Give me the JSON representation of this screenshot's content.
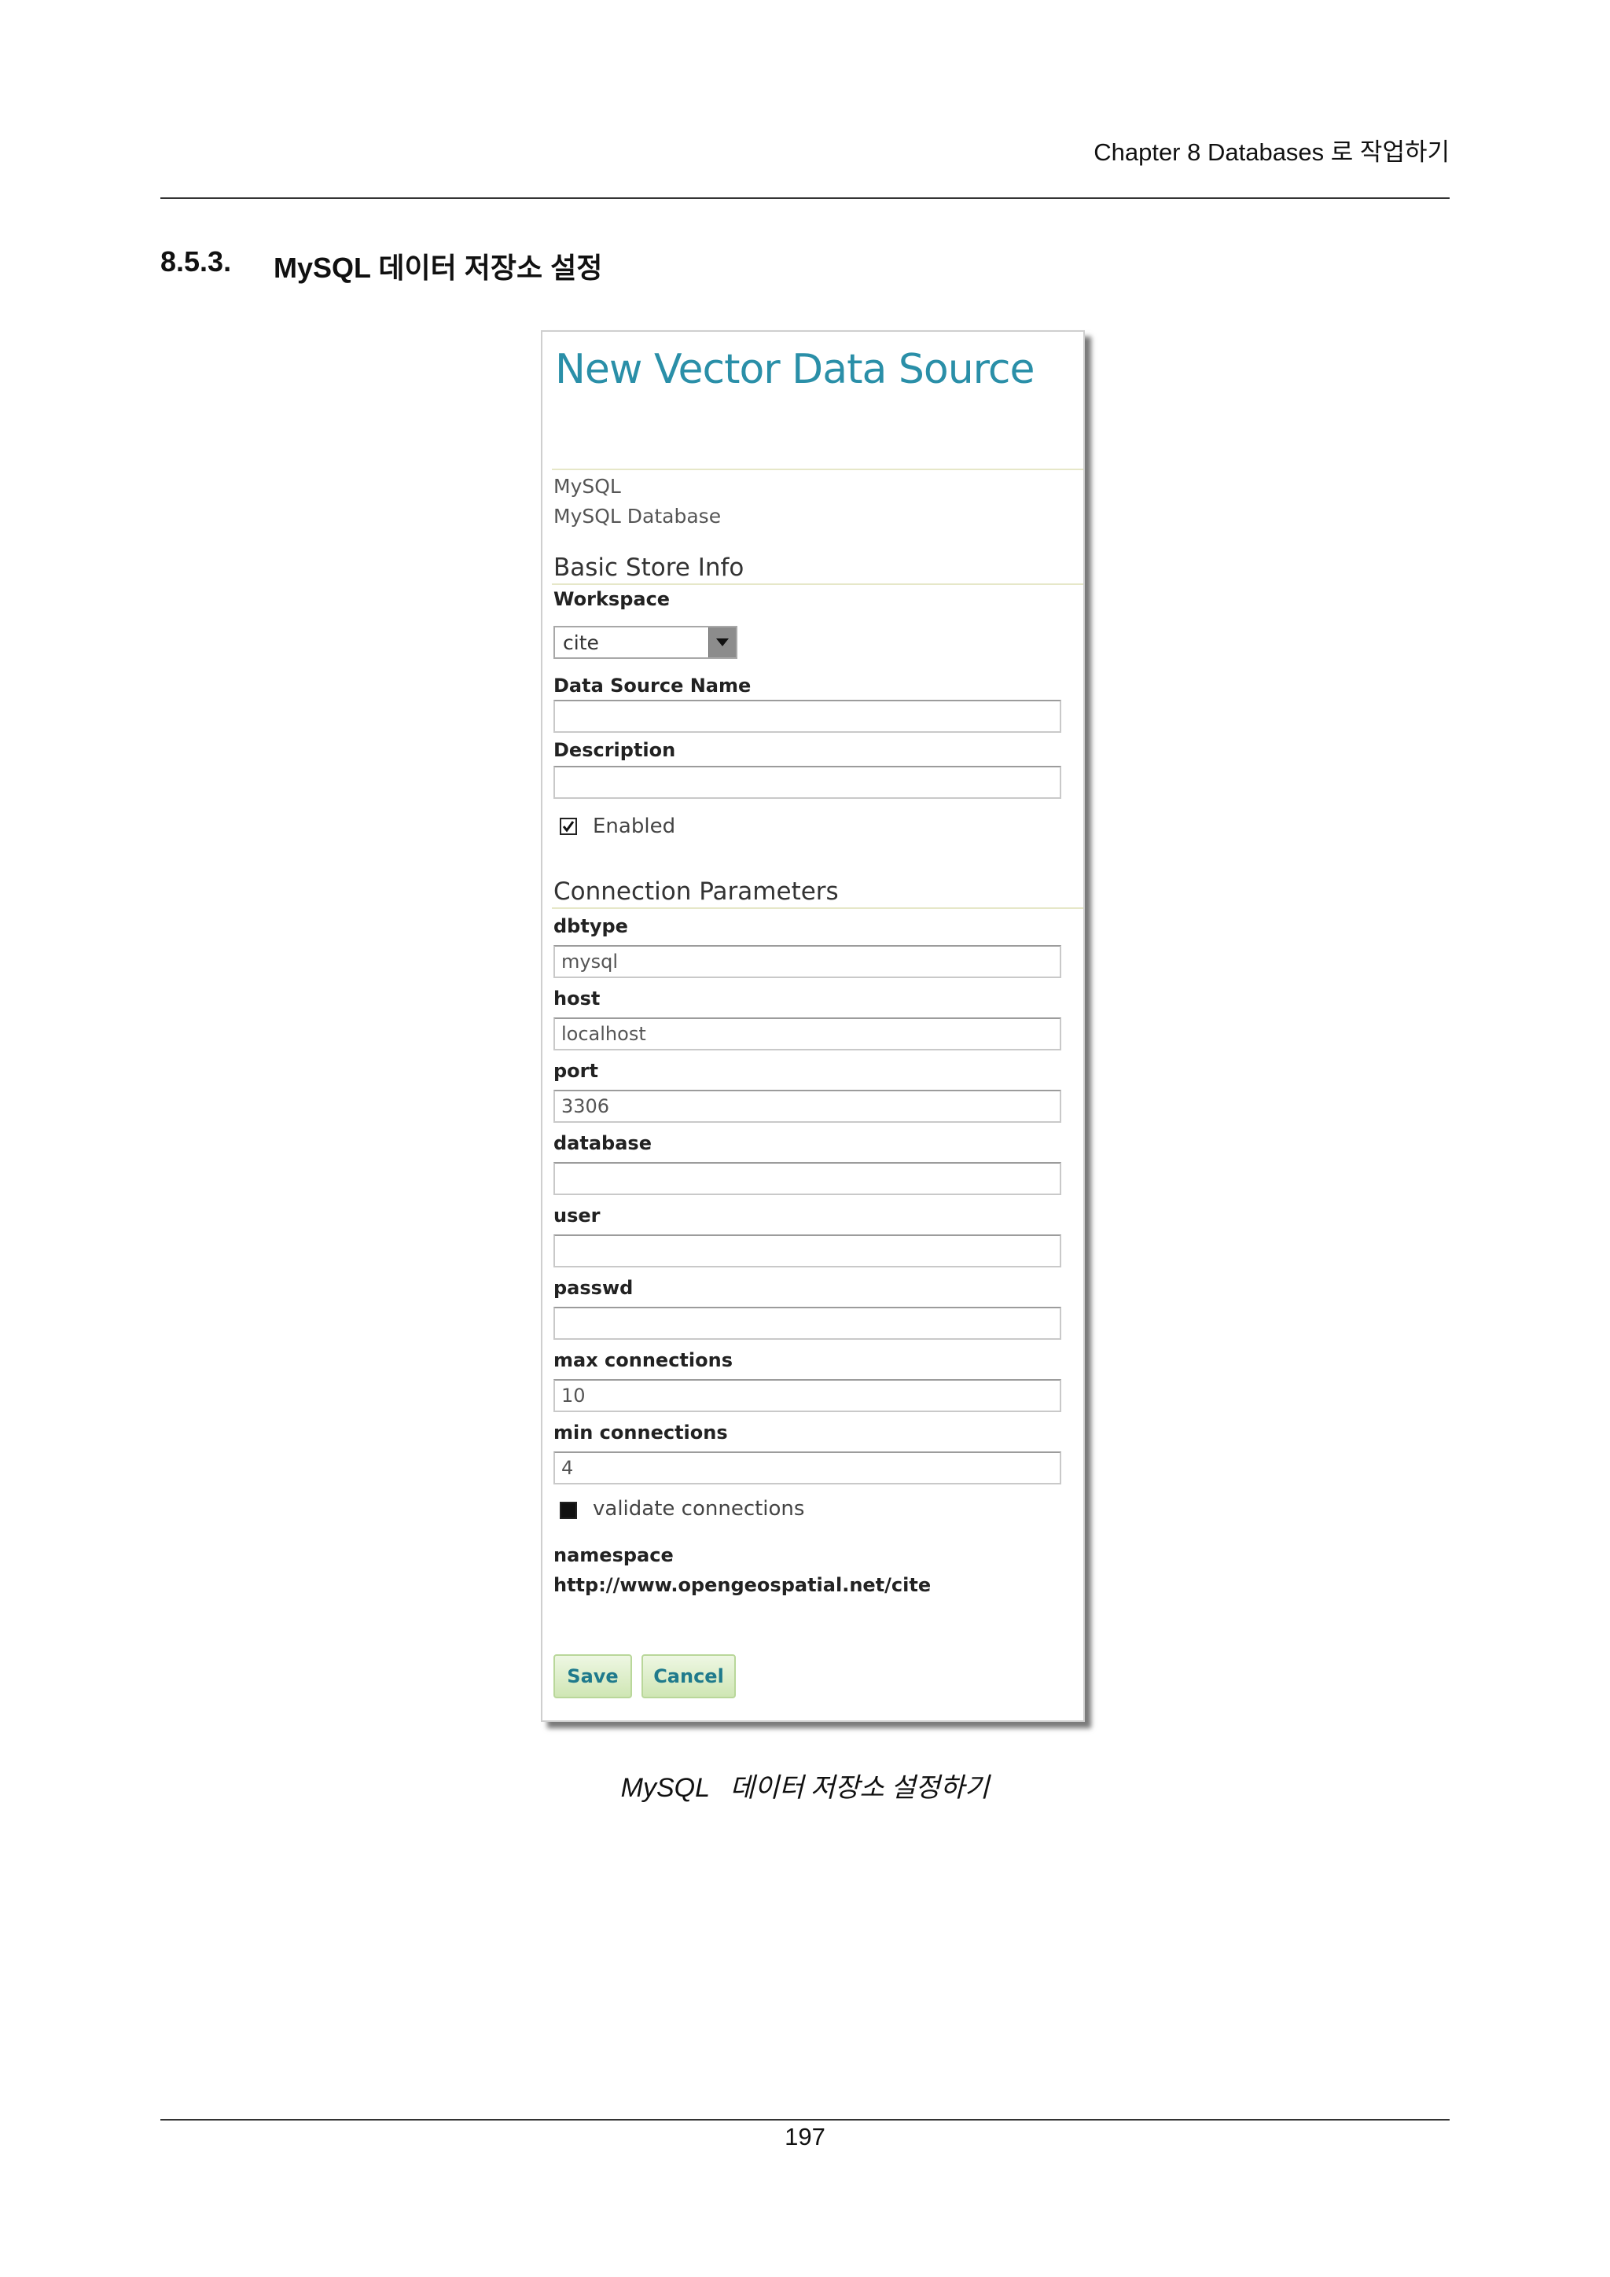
{
  "page": {
    "running_header": "Chapter 8 Databases 로 작업하기",
    "section_number": "8.5.3.",
    "section_title": "MySQL 데이터 저장소 설정",
    "caption_latin": "MySQL",
    "caption_korean": "데이터 저장소 설정하기",
    "page_number": "197"
  },
  "form": {
    "title": "New Vector Data Source",
    "store_type": "MySQL",
    "store_description": "MySQL Database",
    "basic_section": "Basic Store Info",
    "workspace_label": "Workspace",
    "workspace_value": "cite",
    "name_label": "Data Source Name",
    "name_value": "",
    "description_label": "Description",
    "description_value": "",
    "enabled_label": "Enabled",
    "connection_section": "Connection Parameters",
    "params": {
      "dbtype": {
        "label": "dbtype",
        "value": "mysql"
      },
      "host": {
        "label": "host",
        "value": "localhost"
      },
      "port": {
        "label": "port",
        "value": "3306"
      },
      "database": {
        "label": "database",
        "value": ""
      },
      "user": {
        "label": "user",
        "value": ""
      },
      "passwd": {
        "label": "passwd",
        "value": ""
      },
      "max_connections": {
        "label": "max connections",
        "value": "10"
      },
      "min_connections": {
        "label": "min connections",
        "value": "4"
      }
    },
    "validate_label": "validate connections",
    "namespace_label": "namespace",
    "namespace_value": "http://www.opengeospatial.net/cite",
    "save_label": "Save",
    "cancel_label": "Cancel",
    "colors": {
      "title": "#2a8fa8",
      "button_text": "#1f7a8c",
      "button_bg": "#cfe6b4"
    }
  }
}
